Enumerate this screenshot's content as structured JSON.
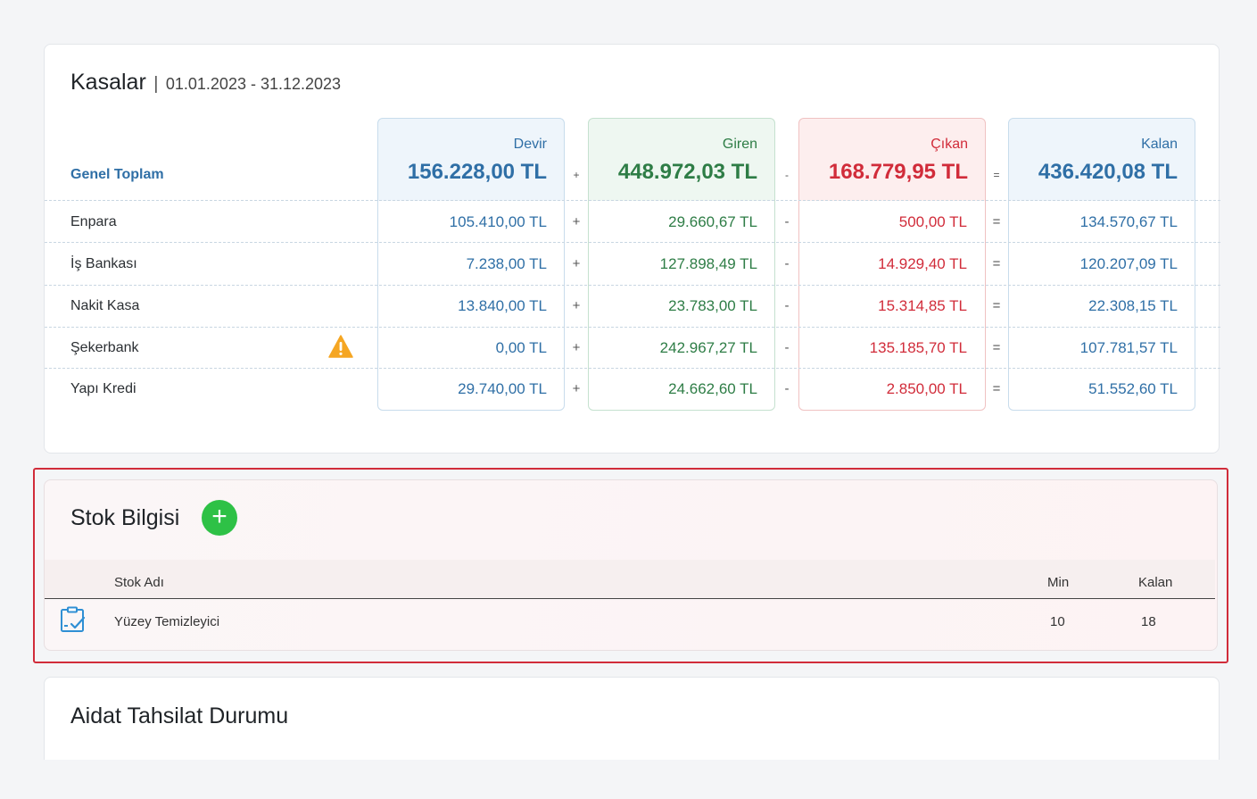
{
  "kasalar": {
    "title": "Kasalar",
    "separator": "|",
    "period": "01.01.2023 - 31.12.2023",
    "genel_toplam_label": "Genel Toplam",
    "columns": {
      "devir": {
        "label": "Devir",
        "total": "156.228,00 TL"
      },
      "giren": {
        "label": "Giren",
        "total": "448.972,03 TL"
      },
      "cikan": {
        "label": "Çıkan",
        "total": "168.779,95 TL"
      },
      "kalan": {
        "label": "Kalan",
        "total": "436.420,08 TL"
      }
    },
    "operators": {
      "plus": "+",
      "minus": "-",
      "equals": "="
    },
    "rows": [
      {
        "name": "Enpara",
        "devir": "105.410,00 TL",
        "giren": "29.660,67 TL",
        "cikan": "500,00 TL",
        "kalan": "134.570,67 TL",
        "warning": false
      },
      {
        "name": "İş Bankası",
        "devir": "7.238,00 TL",
        "giren": "127.898,49 TL",
        "cikan": "14.929,40 TL",
        "kalan": "120.207,09 TL",
        "warning": false
      },
      {
        "name": "Nakit Kasa",
        "devir": "13.840,00 TL",
        "giren": "23.783,00 TL",
        "cikan": "15.314,85 TL",
        "kalan": "22.308,15 TL",
        "warning": false
      },
      {
        "name": "Şekerbank",
        "devir": "0,00 TL",
        "giren": "242.967,27 TL",
        "cikan": "135.185,70 TL",
        "kalan": "107.781,57 TL",
        "warning": true
      },
      {
        "name": "Yapı Kredi",
        "devir": "29.740,00 TL",
        "giren": "24.662,60 TL",
        "cikan": "2.850,00 TL",
        "kalan": "51.552,60 TL",
        "warning": false
      }
    ]
  },
  "stok": {
    "title": "Stok Bilgisi",
    "add_label": "+",
    "headers": {
      "name": "Stok Adı",
      "min": "Min",
      "kalan": "Kalan"
    },
    "items": [
      {
        "name": "Yüzey Temizleyici",
        "min": "10",
        "kalan": "18",
        "icon": "clipboard-check-icon"
      }
    ]
  },
  "aidat": {
    "title": "Aidat Tahsilat Durumu"
  },
  "colors": {
    "blue": "#2f6fa6",
    "green": "#2e7d46",
    "red": "#d12c3a",
    "add_button": "#2ec146",
    "warning": "#f5a623",
    "highlight_outline": "#d12c3a"
  }
}
